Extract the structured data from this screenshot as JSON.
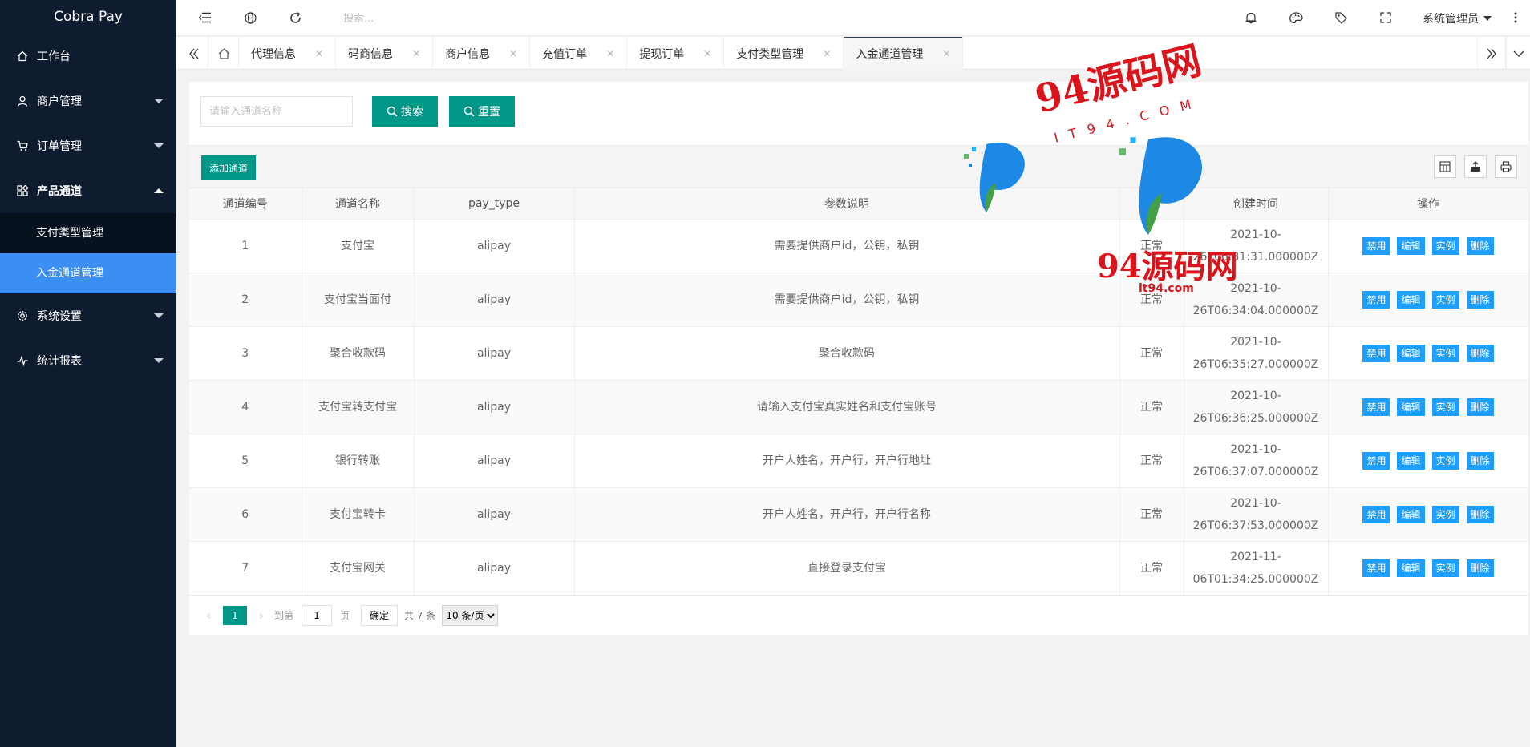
{
  "app": {
    "title": "Cobra Pay"
  },
  "sidebar": {
    "items": [
      {
        "label": "工作台",
        "icon": "home-icon"
      },
      {
        "label": "商户管理",
        "icon": "user-icon"
      },
      {
        "label": "订单管理",
        "icon": "cart-icon"
      },
      {
        "label": "产品通道",
        "icon": "apps-icon"
      },
      {
        "label": "系统设置",
        "icon": "gear-icon"
      },
      {
        "label": "统计报表",
        "icon": "chart-icon"
      }
    ],
    "sub_items": [
      {
        "label": "支付类型管理"
      },
      {
        "label": "入金通道管理"
      }
    ]
  },
  "header": {
    "search_placeholder": "搜索...",
    "user": "系统管理员"
  },
  "tabs": [
    {
      "label": "代理信息"
    },
    {
      "label": "码商信息"
    },
    {
      "label": "商户信息"
    },
    {
      "label": "充值订单"
    },
    {
      "label": "提现订单"
    },
    {
      "label": "支付类型管理"
    },
    {
      "label": "入金通道管理"
    }
  ],
  "search": {
    "placeholder": "请输入通道名称",
    "search_label": "搜索",
    "reset_label": "重置"
  },
  "toolbar": {
    "add_label": "添加通道"
  },
  "table": {
    "headers": [
      "通道编号",
      "通道名称",
      "pay_type",
      "参数说明",
      "",
      "创建时间",
      "操作"
    ],
    "rows": [
      {
        "id": "1",
        "name": "支付宝",
        "pay_type": "alipay",
        "desc": "需要提供商户id，公钥，私钥",
        "status": "正常",
        "time1": "2021-10-",
        "time2": "26T06:31:31.000000Z"
      },
      {
        "id": "2",
        "name": "支付宝当面付",
        "pay_type": "alipay",
        "desc": "需要提供商户id，公钥，私钥",
        "status": "正常",
        "time1": "2021-10-",
        "time2": "26T06:34:04.000000Z"
      },
      {
        "id": "3",
        "name": "聚合收款码",
        "pay_type": "alipay",
        "desc": "聚合收款码",
        "status": "正常",
        "time1": "2021-10-",
        "time2": "26T06:35:27.000000Z"
      },
      {
        "id": "4",
        "name": "支付宝转支付宝",
        "pay_type": "alipay",
        "desc": "请输入支付宝真实姓名和支付宝账号",
        "status": "正常",
        "time1": "2021-10-",
        "time2": "26T06:36:25.000000Z"
      },
      {
        "id": "5",
        "name": "银行转账",
        "pay_type": "alipay",
        "desc": "开户人姓名，开户行，开户行地址",
        "status": "正常",
        "time1": "2021-10-",
        "time2": "26T06:37:07.000000Z"
      },
      {
        "id": "6",
        "name": "支付宝转卡",
        "pay_type": "alipay",
        "desc": "开户人姓名，开户行，开户行名称",
        "status": "正常",
        "time1": "2021-10-",
        "time2": "26T06:37:53.000000Z"
      },
      {
        "id": "7",
        "name": "支付宝网关",
        "pay_type": "alipay",
        "desc": "直接登录支付宝",
        "status": "正常",
        "time1": "2021-11-",
        "time2": "06T01:34:25.000000Z"
      }
    ],
    "ops": {
      "disable": "禁用",
      "edit": "编辑",
      "example": "实例",
      "delete": "删除"
    }
  },
  "pager": {
    "current": "1",
    "goto_label": "到第",
    "goto_value": "1",
    "page_label": "页",
    "ok_label": "确定",
    "total": "共 7 条",
    "page_size": "10 条/页"
  },
  "watermark": {
    "main": "94源码网",
    "sub": "IT94.COM",
    "main2": "94源码网",
    "sub2": "it94.com"
  },
  "colors": {
    "sidebar": "#0f1b2e",
    "active": "#3b8ff3",
    "teal": "#009688",
    "op_blue": "#1e9fff"
  }
}
